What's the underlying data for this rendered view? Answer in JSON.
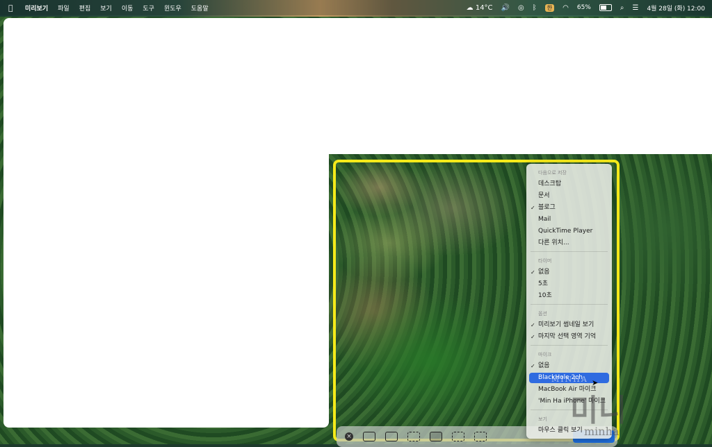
{
  "menubar": {
    "app_name": "미리보기",
    "items": [
      "파일",
      "편집",
      "보기",
      "이동",
      "도구",
      "윈도우",
      "도움말"
    ],
    "weather": "14°C",
    "input_badge": "한",
    "battery_percent": "65%",
    "battery_level": 0.65,
    "datetime": "4월 28일 (화) 12:00"
  },
  "menu": {
    "save_to_header": "다음으로 저장",
    "save_to": [
      {
        "label": "데스크탑",
        "checked": false
      },
      {
        "label": "문서",
        "checked": false
      },
      {
        "label": "블로그",
        "checked": true
      },
      {
        "label": "Mail",
        "checked": false
      },
      {
        "label": "QuickTime Player",
        "checked": false
      },
      {
        "label": "다른 위치...",
        "checked": false
      }
    ],
    "timer_header": "타이머",
    "timer": [
      {
        "label": "없음",
        "checked": true
      },
      {
        "label": "5초",
        "checked": false
      },
      {
        "label": "10초",
        "checked": false
      }
    ],
    "options_header": "옵션",
    "options": [
      {
        "label": "미리보기 썸네일 보기",
        "checked": true
      },
      {
        "label": "마지막 선택 영역 기억",
        "checked": true
      }
    ],
    "mic_header": "마이크",
    "mic": [
      {
        "label": "없음",
        "checked": true
      },
      {
        "label": "BlackHole 2ch",
        "checked": false,
        "highlighted": true
      },
      {
        "label": "MacBook Air 마이크",
        "checked": false
      },
      {
        "label": "'Min Ha iPhone' 마이크",
        "checked": false
      }
    ],
    "show_header": "보기",
    "show": [
      {
        "label": "마우스 클릭 보기",
        "checked": false
      }
    ]
  },
  "watermark": {
    "line1": "MINHA",
    "line2": "미니",
    "line3": "minha"
  },
  "colors": {
    "selection": "#f5ea1a",
    "highlight": "#2f6be0"
  }
}
